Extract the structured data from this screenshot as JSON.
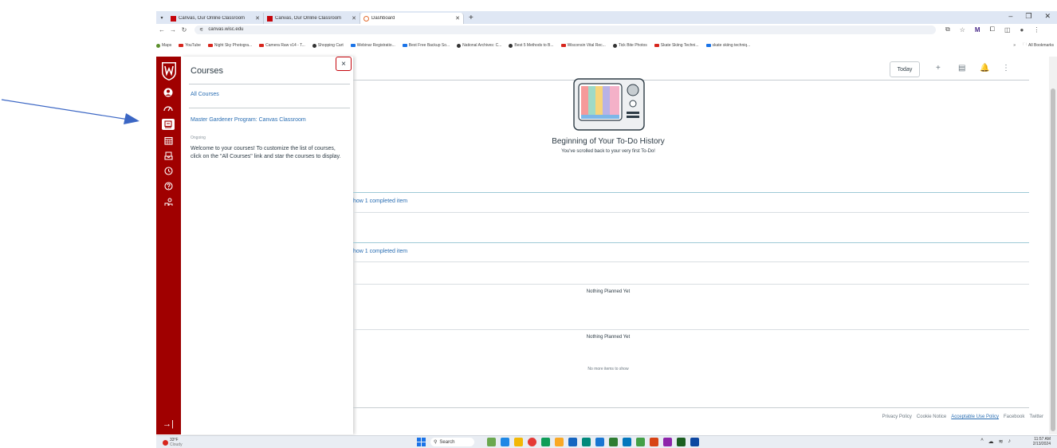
{
  "colors": {
    "brand": "#a00000",
    "link": "#2a6eb3",
    "text": "#2d3b45"
  },
  "browser": {
    "tabs": [
      {
        "title": "Canvas, Our Online Classroom",
        "active": false
      },
      {
        "title": "Canvas, Our Online Classroom",
        "active": false
      },
      {
        "title": "Dashboard",
        "active": true
      }
    ],
    "url": "canvas.wisc.edu",
    "bookmarks": [
      "Maps",
      "YouTube",
      "Night Sky Photogra...",
      "Camera Raw v14 - T...",
      "Shopping Cart",
      "Webinar Registratio...",
      "Best Free Backup So...",
      "National Archives: C...",
      "Best 5 Methods to B...",
      "Wisconsin Vital Rec...",
      "Tick Bite Photos",
      "Skate Skiing Techni...",
      "skate skiing techniq..."
    ],
    "all_bookmarks": "All Bookmarks"
  },
  "tray": {
    "title": "Courses",
    "close": "×",
    "all_courses": "All Courses",
    "course_name": "Master Gardener Program: Canvas Classroom",
    "course_term": "Ongoing",
    "welcome": "Welcome to your courses! To customize the list of courses, click on the \"All Courses\" link and star the courses to display."
  },
  "main": {
    "today": "Today",
    "history_title": "Beginning of Your To-Do History",
    "history_sub": "You've scrolled back to your very first To-Do!",
    "show_completed_1": "how 1 completed item",
    "show_completed_2": "how 1 completed item",
    "nothing_1": "Nothing Planned Yet",
    "nothing_2": "Nothing Planned Yet",
    "no_more": "No more items to show"
  },
  "footer": {
    "privacy": "Privacy Policy",
    "cookie": "Cookie Notice",
    "acceptable": "Acceptable Use Policy",
    "facebook": "Facebook",
    "twitter": "Twitter"
  },
  "taskbar": {
    "weather_temp": "33°F",
    "weather_desc": "Cloudy",
    "search": "Search",
    "time": "11:57 AM",
    "date": "2/13/2024"
  }
}
